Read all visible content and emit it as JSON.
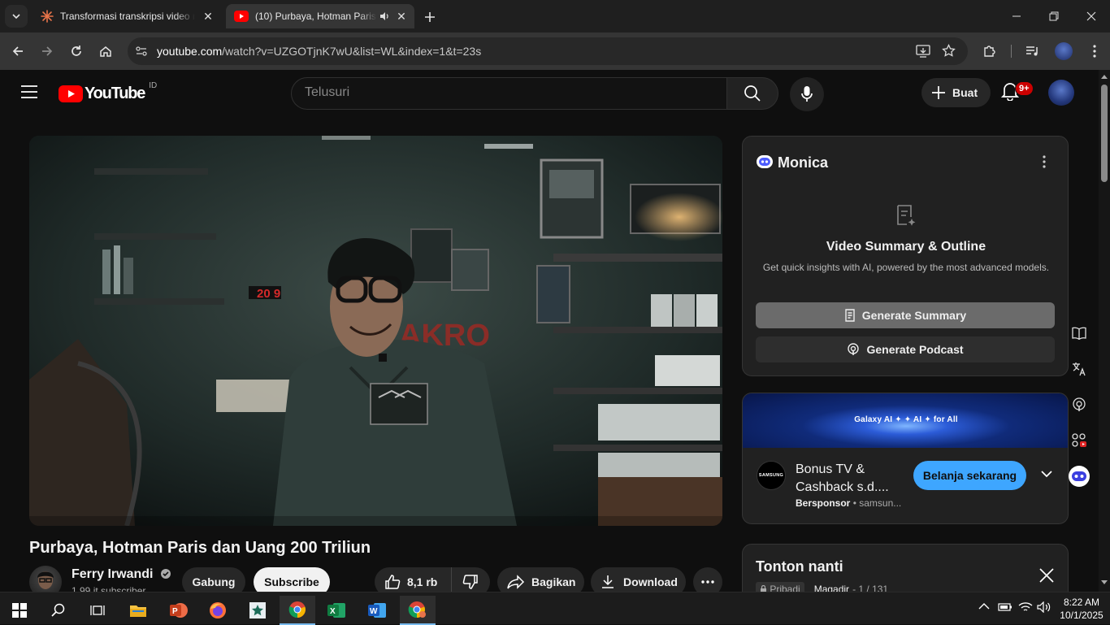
{
  "browser": {
    "tabs": [
      {
        "title": "Transformasi transkripsi video n",
        "favicon": "sparkle-icon"
      },
      {
        "title": "(10) Purbaya, Hotman Paris",
        "favicon": "youtube-icon",
        "audio": true
      }
    ],
    "url_domain": "youtube.com",
    "url_path": "/watch?v=UZGOTjnK7wU&list=WL&index=1&t=23s"
  },
  "youtube": {
    "logo_text": "YouTube",
    "country": "ID",
    "search_placeholder": "Telusuri",
    "create_label": "Buat",
    "notification_count": "9+"
  },
  "video": {
    "title": "Purbaya, Hotman Paris dan Uang 200 Triliun",
    "channel": "Ferry Irwandi",
    "subscribers": "1,99 jt subscriber",
    "join_label": "Gabung",
    "subscribe_label": "Subscribe",
    "likes": "8,1 rb",
    "share_label": "Bagikan",
    "download_label": "Download"
  },
  "monica": {
    "title": "Monica",
    "heading": "Video Summary & Outline",
    "subtitle": "Get quick insights with AI, powered by the most advanced models.",
    "summary_button": "Generate Summary",
    "podcast_button": "Generate Podcast"
  },
  "ad": {
    "banner_text": "Galaxy AI ✦  ✦  AI ✦ for All",
    "logo_text": "SAMSUNG",
    "title": "Bonus TV & Cashback s.d....",
    "sponsor_label": "Bersponsor",
    "sponsor_domain": "samsun...",
    "cta": "Belanja sekarang"
  },
  "playlist": {
    "title": "Tonton nanti",
    "privacy": "Pribadi",
    "owner": "Magadir",
    "position": "- 1 / 131"
  },
  "taskbar": {
    "time": "8:22 AM",
    "date": "10/1/2025"
  },
  "colors": {
    "yt_red": "#ff0000",
    "subscribe_bg": "#f1f1f1",
    "cta_blue": "#3ea6ff",
    "monica_button": "#6b6b6b"
  }
}
